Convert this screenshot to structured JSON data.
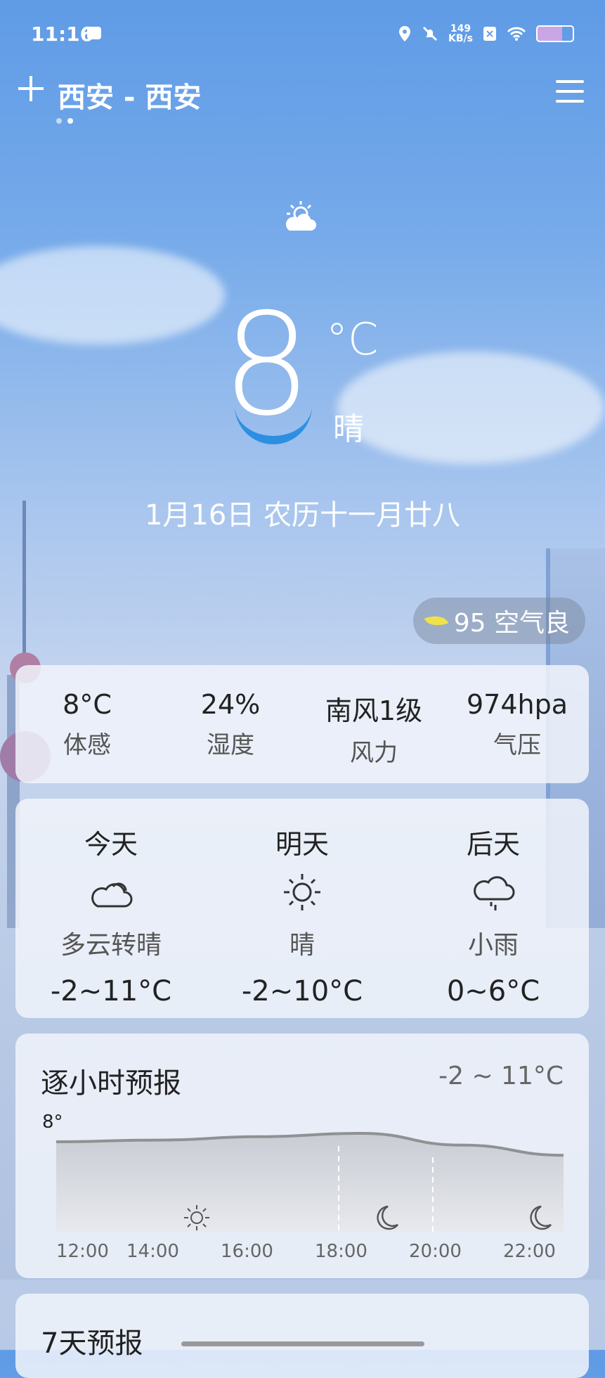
{
  "statusbar": {
    "time": "11:16",
    "net_speed_value": "149",
    "net_speed_unit": "KB/s"
  },
  "header": {
    "city": "西安 - 西安"
  },
  "current": {
    "temperature": "8",
    "unit": "°C",
    "condition": "晴",
    "date": "1月16日 农历十一月廿八"
  },
  "aqi": {
    "label": "95 空气良"
  },
  "stats": [
    {
      "value": "8°C",
      "label": "体感"
    },
    {
      "value": "24%",
      "label": "湿度"
    },
    {
      "value": "南风1级",
      "label": "风力"
    },
    {
      "value": "974hpa",
      "label": "气压"
    }
  ],
  "days": [
    {
      "name": "今天",
      "icon": "cloud-icon",
      "desc": "多云转晴",
      "range": "-2~11°C"
    },
    {
      "name": "明天",
      "icon": "sun-icon",
      "desc": "晴",
      "range": "-2~10°C"
    },
    {
      "name": "后天",
      "icon": "rain-icon",
      "desc": "小雨",
      "range": "0~6°C"
    }
  ],
  "hourly": {
    "title": "逐小时预报",
    "range": "-2 ~ 11°C",
    "first_label": "8°",
    "times": [
      "12:00",
      "14:00",
      "16:00",
      "18:00",
      "20:00",
      "22:00"
    ],
    "icons": [
      "sun-icon",
      "moon-icon",
      "moon-icon"
    ]
  },
  "week": {
    "title": "7天预报"
  },
  "chart_data": {
    "type": "area",
    "x": [
      "12:00",
      "14:00",
      "16:00",
      "18:00",
      "20:00",
      "22:00"
    ],
    "ylabel": "",
    "series": [
      {
        "values": [
          8,
          8.2,
          8.6,
          9,
          7.6,
          6.4
        ]
      }
    ]
  }
}
